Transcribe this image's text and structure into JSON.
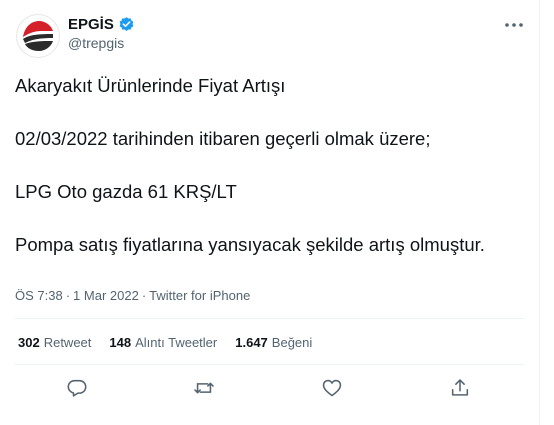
{
  "user": {
    "display_name": "EPGİS",
    "handle": "@trepgis",
    "verified": true,
    "avatar_icon": "epgis-logo-icon",
    "brand_colors": {
      "red": "#d4202a",
      "dark": "#2b2b2b"
    }
  },
  "tweet": {
    "paragraphs": [
      "Akaryakıt Ürünlerinde Fiyat Artışı",
      "02/03/2022 tarihinden itibaren geçerli olmak üzere;",
      "LPG Oto gazda 61 KRŞ/LT",
      "Pompa satış fiyatlarına yansıyacak şekilde artış olmuştur."
    ],
    "time": "ÖS 7:38",
    "date": "1 Mar 2022",
    "source": "Twitter for iPhone"
  },
  "stats": {
    "retweets": {
      "count": "302",
      "label": "Retweet"
    },
    "quotes": {
      "count": "148",
      "label": "Alıntı Tweetler"
    },
    "likes": {
      "count": "1.647",
      "label": "Beğeni"
    }
  },
  "actions": [
    "reply-icon",
    "retweet-icon",
    "like-icon",
    "share-icon"
  ],
  "colors": {
    "text": "#0f1419",
    "secondary": "#536471",
    "verified": "#1d9bf0",
    "divider": "#eff3f4"
  }
}
